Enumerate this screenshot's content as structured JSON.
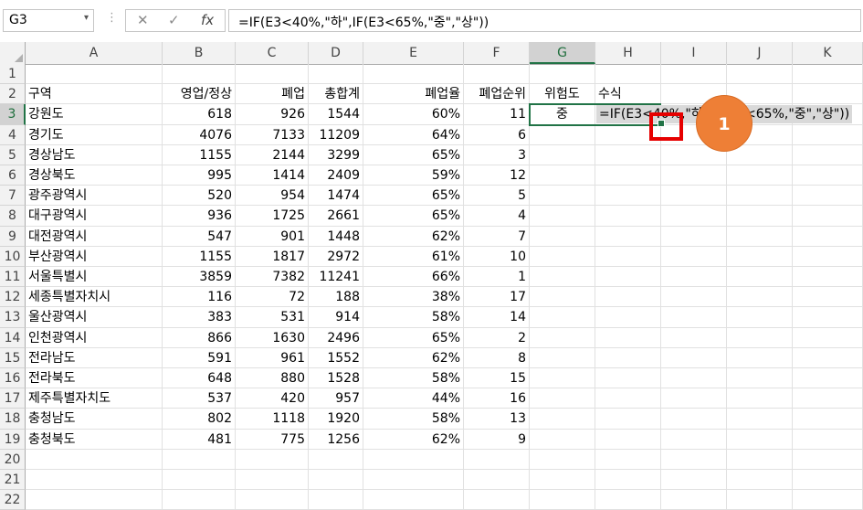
{
  "formula_bar": {
    "name_box": "G3",
    "name_box_dropdown": "▾",
    "separator": "⋮",
    "cancel": "✕",
    "enter": "✓",
    "fx": "fx",
    "formula": "=IF(E3<40%,\"하\",IF(E3<65%,\"중\",\"상\"))"
  },
  "columns": [
    "A",
    "B",
    "C",
    "D",
    "E",
    "F",
    "G",
    "H",
    "I",
    "J",
    "K"
  ],
  "selected_column": "G",
  "selected_row": "3",
  "rows": [
    {
      "n": "1",
      "a": "",
      "b": "",
      "c": "",
      "d": "",
      "e": "",
      "f": "",
      "g": "",
      "h": ""
    },
    {
      "n": "2",
      "a": "구역",
      "b": "영업/정상",
      "c": "폐업",
      "d": "총합계",
      "e": "폐업율",
      "f": "폐업순위",
      "g": "위험도",
      "h": "수식"
    },
    {
      "n": "3",
      "a": "강원도",
      "b": "618",
      "c": "926",
      "d": "1544",
      "e": "60%",
      "f": "11",
      "g": "중",
      "h": ""
    },
    {
      "n": "4",
      "a": "경기도",
      "b": "4076",
      "c": "7133",
      "d": "11209",
      "e": "64%",
      "f": "6",
      "g": "",
      "h": ""
    },
    {
      "n": "5",
      "a": "경상남도",
      "b": "1155",
      "c": "2144",
      "d": "3299",
      "e": "65%",
      "f": "3",
      "g": "",
      "h": ""
    },
    {
      "n": "6",
      "a": "경상북도",
      "b": "995",
      "c": "1414",
      "d": "2409",
      "e": "59%",
      "f": "12",
      "g": "",
      "h": ""
    },
    {
      "n": "7",
      "a": "광주광역시",
      "b": "520",
      "c": "954",
      "d": "1474",
      "e": "65%",
      "f": "5",
      "g": "",
      "h": ""
    },
    {
      "n": "8",
      "a": "대구광역시",
      "b": "936",
      "c": "1725",
      "d": "2661",
      "e": "65%",
      "f": "4",
      "g": "",
      "h": ""
    },
    {
      "n": "9",
      "a": "대전광역시",
      "b": "547",
      "c": "901",
      "d": "1448",
      "e": "62%",
      "f": "7",
      "g": "",
      "h": ""
    },
    {
      "n": "10",
      "a": "부산광역시",
      "b": "1155",
      "c": "1817",
      "d": "2972",
      "e": "61%",
      "f": "10",
      "g": "",
      "h": ""
    },
    {
      "n": "11",
      "a": "서울특별시",
      "b": "3859",
      "c": "7382",
      "d": "11241",
      "e": "66%",
      "f": "1",
      "g": "",
      "h": ""
    },
    {
      "n": "12",
      "a": "세종특별자치시",
      "b": "116",
      "c": "72",
      "d": "188",
      "e": "38%",
      "f": "17",
      "g": "",
      "h": ""
    },
    {
      "n": "13",
      "a": "울산광역시",
      "b": "383",
      "c": "531",
      "d": "914",
      "e": "58%",
      "f": "14",
      "g": "",
      "h": ""
    },
    {
      "n": "14",
      "a": "인천광역시",
      "b": "866",
      "c": "1630",
      "d": "2496",
      "e": "65%",
      "f": "2",
      "g": "",
      "h": ""
    },
    {
      "n": "15",
      "a": "전라남도",
      "b": "591",
      "c": "961",
      "d": "1552",
      "e": "62%",
      "f": "8",
      "g": "",
      "h": ""
    },
    {
      "n": "16",
      "a": "전라북도",
      "b": "648",
      "c": "880",
      "d": "1528",
      "e": "58%",
      "f": "15",
      "g": "",
      "h": ""
    },
    {
      "n": "17",
      "a": "제주특별자치도",
      "b": "537",
      "c": "420",
      "d": "957",
      "e": "44%",
      "f": "16",
      "g": "",
      "h": ""
    },
    {
      "n": "18",
      "a": "충청남도",
      "b": "802",
      "c": "1118",
      "d": "1920",
      "e": "58%",
      "f": "13",
      "g": "",
      "h": ""
    },
    {
      "n": "19",
      "a": "충청북도",
      "b": "481",
      "c": "775",
      "d": "1256",
      "e": "62%",
      "f": "9",
      "g": "",
      "h": ""
    },
    {
      "n": "20",
      "a": "",
      "b": "",
      "c": "",
      "d": "",
      "e": "",
      "f": "",
      "g": "",
      "h": ""
    },
    {
      "n": "21",
      "a": "",
      "b": "",
      "c": "",
      "d": "",
      "e": "",
      "f": "",
      "g": "",
      "h": ""
    },
    {
      "n": "22",
      "a": "",
      "b": "",
      "c": "",
      "d": "",
      "e": "",
      "f": "",
      "g": "",
      "h": ""
    }
  ],
  "h3_formula_text": "=IF(E3<40%,\"하\",IF(E3<65%,\"중\",\"상\"))",
  "callout": {
    "label": "1"
  },
  "colors": {
    "accent": "#217346",
    "highlight": "#e60000",
    "callout": "#ee7f36"
  }
}
